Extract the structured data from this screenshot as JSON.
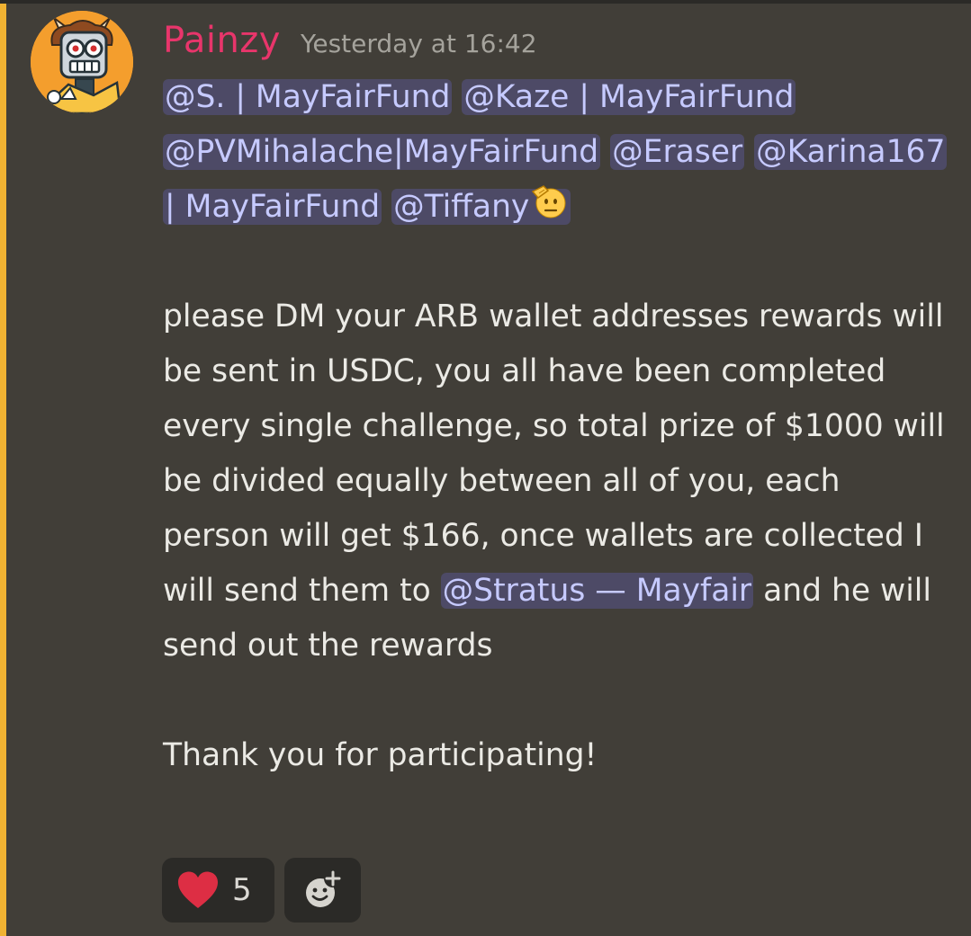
{
  "message": {
    "author": "Painzy",
    "timestamp": "Yesterday at 16:42",
    "mentions": [
      "@S. | MayFairFund",
      "@Kaze | MayFairFund",
      "@PVMihalache|MayFairFund",
      "@Eraser",
      "@Karina167 | MayFairFund",
      "@Tiffany"
    ],
    "body": {
      "part1": "please DM your ARB wallet addresses rewards will be sent in USDC, you all have been completed every single challenge, so total prize of $1000 will be divided equally between all of you, each person will get $166, once wallets are collected I will send them to",
      "mention": "@Stratus — Mayfair",
      "part2": " and he will send out the rewards",
      "closing": "Thank you for participating!"
    },
    "saluting_emoji": "saluting-face-emoji",
    "avatar_icon": "robot-avatar-icon"
  },
  "reactions": [
    {
      "emoji": "heart-icon",
      "count": "5"
    },
    {
      "emoji": "add-reaction-icon"
    }
  ],
  "colors": {
    "background": "#413e38",
    "accent_bar": "#f0b232",
    "username": "#e8356b",
    "mention_bg": "#4d4a66",
    "mention_text": "#c6caff",
    "heart": "#dd2e44"
  }
}
